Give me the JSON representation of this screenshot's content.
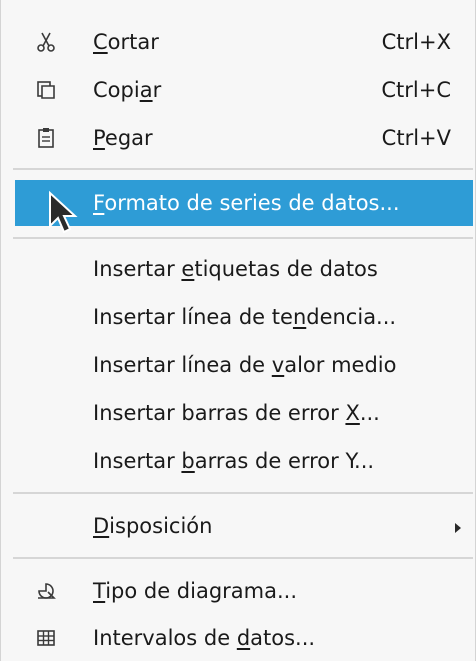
{
  "menu": {
    "items": [
      {
        "label_pre": "",
        "label_u": "C",
        "label_post": "ortar",
        "shortcut": "Ctrl+X",
        "icon": "scissors-icon"
      },
      {
        "label_pre": "Copi",
        "label_u": "a",
        "label_post": "r",
        "shortcut": "Ctrl+C",
        "icon": "copy-icon"
      },
      {
        "label_pre": "",
        "label_u": "P",
        "label_post": "egar",
        "shortcut": "Ctrl+V",
        "icon": "paste-icon"
      },
      {
        "label_pre": "",
        "label_u": "F",
        "label_post": "ormato de series de datos...",
        "shortcut": "",
        "icon": ""
      },
      {
        "label_pre": "Insertar ",
        "label_u": "e",
        "label_post": "tiquetas de datos",
        "shortcut": "",
        "icon": ""
      },
      {
        "label_pre": "Insertar línea de te",
        "label_u": "n",
        "label_post": "dencia...",
        "shortcut": "",
        "icon": ""
      },
      {
        "label_pre": "Insertar línea de ",
        "label_u": "v",
        "label_post": "alor medio",
        "shortcut": "",
        "icon": ""
      },
      {
        "label_pre": "Insertar barras de error ",
        "label_u": "X",
        "label_post": "...",
        "shortcut": "",
        "icon": ""
      },
      {
        "label_pre": "Insertar ",
        "label_u": "b",
        "label_post": "arras de error Y...",
        "shortcut": "",
        "icon": ""
      },
      {
        "label_pre": "",
        "label_u": "D",
        "label_post": "isposición",
        "shortcut": "",
        "icon": "submenu-arrow"
      },
      {
        "label_pre": "",
        "label_u": "T",
        "label_post": "ipo de diagrama...",
        "shortcut": "",
        "icon": "chart-type-icon"
      },
      {
        "label_pre": "Intervalos de ",
        "label_u": "d",
        "label_post": "atos...",
        "shortcut": "",
        "icon": "data-ranges-icon"
      }
    ],
    "highlight_color": "#2e9cd6"
  }
}
